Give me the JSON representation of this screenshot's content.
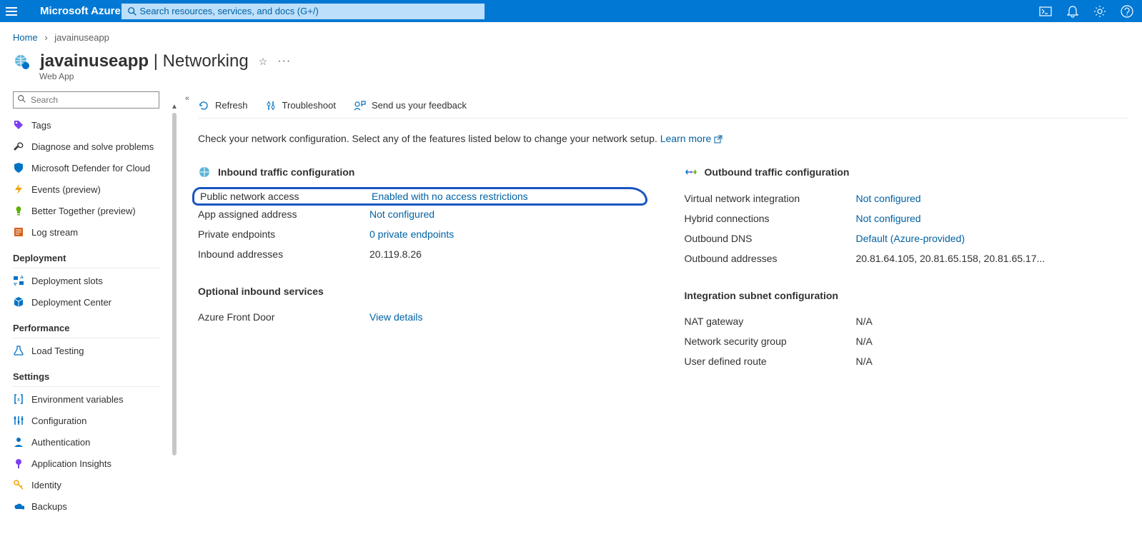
{
  "top": {
    "brand": "Microsoft Azure",
    "search_placeholder": "Search resources, services, and docs (G+/)"
  },
  "breadcrumb": {
    "home": "Home",
    "current": "javainuseapp"
  },
  "page": {
    "title": "javainuseapp",
    "section": "Networking",
    "subtitle": "Web App"
  },
  "sidebar": {
    "search_placeholder": "Search",
    "items_top": [
      {
        "label": "Tags",
        "icon": "tag",
        "color": "#7e3ff2"
      },
      {
        "label": "Diagnose and solve problems",
        "icon": "wrench",
        "color": "#323130"
      },
      {
        "label": "Microsoft Defender for Cloud",
        "icon": "shield",
        "color": "#0072c6"
      },
      {
        "label": "Events (preview)",
        "icon": "bolt",
        "color": "#f2a100"
      },
      {
        "label": "Better Together (preview)",
        "icon": "bulb",
        "color": "#5db300"
      },
      {
        "label": "Log stream",
        "icon": "log",
        "color": "#d55f1b"
      }
    ],
    "group_deployment": "Deployment",
    "items_deployment": [
      {
        "label": "Deployment slots",
        "icon": "slots",
        "color": "#0072c6"
      },
      {
        "label": "Deployment Center",
        "icon": "cube",
        "color": "#0072c6"
      }
    ],
    "group_performance": "Performance",
    "items_performance": [
      {
        "label": "Load Testing",
        "icon": "flask",
        "color": "#0072c6"
      }
    ],
    "group_settings": "Settings",
    "items_settings": [
      {
        "label": "Environment variables",
        "icon": "brackets",
        "color": "#0072c6"
      },
      {
        "label": "Configuration",
        "icon": "sliders",
        "color": "#0072c6"
      },
      {
        "label": "Authentication",
        "icon": "person",
        "color": "#0072c6"
      },
      {
        "label": "Application Insights",
        "icon": "insights",
        "color": "#7e3ff2"
      },
      {
        "label": "Identity",
        "icon": "key",
        "color": "#f2a100"
      },
      {
        "label": "Backups",
        "icon": "cloud",
        "color": "#0072c6"
      }
    ]
  },
  "toolbar": {
    "refresh": "Refresh",
    "troubleshoot": "Troubleshoot",
    "feedback": "Send us your feedback"
  },
  "description": {
    "text": "Check your network configuration. Select any of the features listed below to change your network setup. ",
    "learn": "Learn more"
  },
  "inbound": {
    "heading": "Inbound traffic configuration",
    "rows": [
      {
        "k": "Public network access",
        "v": "Enabled with no access restrictions",
        "link": true,
        "hl": true
      },
      {
        "k": "App assigned address",
        "v": "Not configured",
        "link": true
      },
      {
        "k": "Private endpoints",
        "v": "0 private endpoints",
        "link": true
      },
      {
        "k": "Inbound addresses",
        "v": "20.119.8.26",
        "link": false
      }
    ]
  },
  "optional_inbound": {
    "heading": "Optional inbound services",
    "rows": [
      {
        "k": "Azure Front Door",
        "v": "View details",
        "link": true
      }
    ]
  },
  "outbound": {
    "heading": "Outbound traffic configuration",
    "rows": [
      {
        "k": "Virtual network integration",
        "v": "Not configured",
        "link": true
      },
      {
        "k": "Hybrid connections",
        "v": "Not configured",
        "link": true
      },
      {
        "k": "Outbound DNS",
        "v": "Default (Azure-provided)",
        "link": true
      },
      {
        "k": "Outbound addresses",
        "v": "20.81.64.105, 20.81.65.158, 20.81.65.17...",
        "link": false
      }
    ]
  },
  "subnet": {
    "heading": "Integration subnet configuration",
    "rows": [
      {
        "k": "NAT gateway",
        "v": "N/A",
        "link": false
      },
      {
        "k": "Network security group",
        "v": "N/A",
        "link": false
      },
      {
        "k": "User defined route",
        "v": "N/A",
        "link": false
      }
    ]
  }
}
